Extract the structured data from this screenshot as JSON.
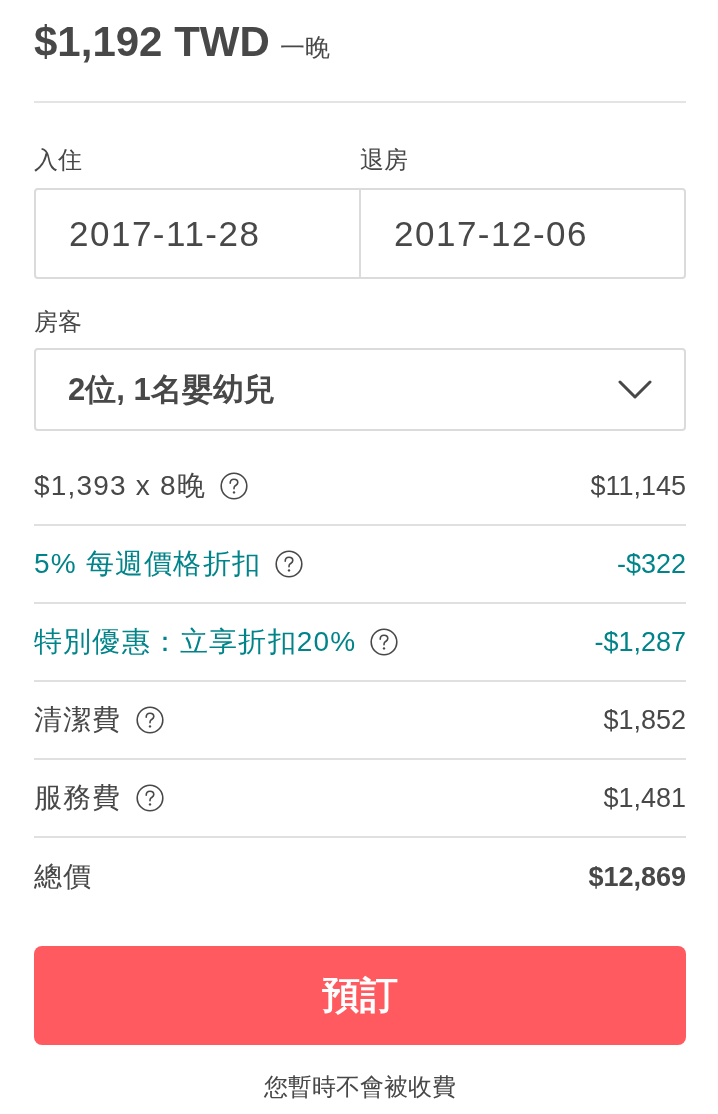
{
  "price": {
    "amount": "$1,192 TWD",
    "unit": "一晚"
  },
  "dates": [
    {
      "label": "入住",
      "value": "2017-11-28"
    },
    {
      "label": "退房",
      "value": "2017-12-06"
    }
  ],
  "guests": {
    "label": "房客",
    "value": "2位, 1名嬰幼兒"
  },
  "line_items": [
    {
      "kind": "charge",
      "label": "$1,393 x 8晚",
      "info": true,
      "amount": "$11,145"
    },
    {
      "kind": "discount",
      "label": "5% 每週價格折扣",
      "info": true,
      "amount": "-$322"
    },
    {
      "kind": "discount",
      "label": "特別優惠：立享折扣20%",
      "info": true,
      "amount": "-$1,287"
    },
    {
      "kind": "charge",
      "label": "清潔費",
      "info": true,
      "amount": "$1,852"
    },
    {
      "kind": "charge",
      "label": "服務費",
      "info": true,
      "amount": "$1,481"
    },
    {
      "kind": "total",
      "label": "總價",
      "info": false,
      "amount": "$12,869"
    }
  ],
  "book_button": "預訂",
  "note": "您暫時不會被收費"
}
